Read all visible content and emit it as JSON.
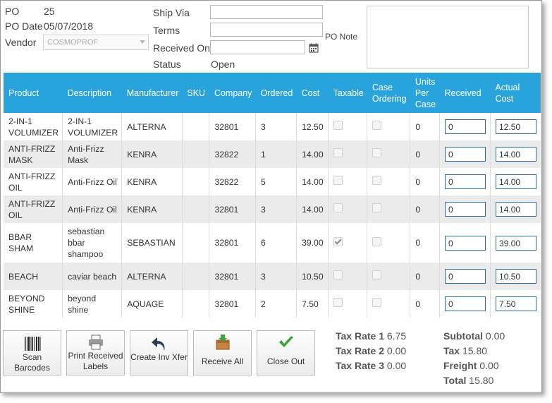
{
  "header": {
    "po_label": "PO",
    "po_value": "25",
    "po_date_label": "PO Date",
    "po_date_value": "05/07/2018",
    "vendor_label": "Vendor",
    "vendor_value": "COSMOPROF",
    "ship_via_label": "Ship Via",
    "ship_via_value": "",
    "terms_label": "Terms",
    "terms_value": "",
    "received_on_label": "Received On",
    "received_on_value": "",
    "status_label": "Status",
    "status_value": "Open",
    "po_note_label": "PO Note",
    "po_note_value": ""
  },
  "table": {
    "columns": [
      "Product",
      "Description",
      "Manufacturer",
      "SKU",
      "Company",
      "Ordered",
      "Cost",
      "Taxable",
      "Case Ordering",
      "Units Per Case",
      "Received",
      "Actual Cost"
    ],
    "rows": [
      {
        "product": "2-IN-1 VOLUMIZER",
        "description": "2-IN-1 VOLUMIZER",
        "manufacturer": "ALTERNA",
        "sku": "",
        "company": "32801",
        "ordered": "3",
        "cost": "12.50",
        "taxable": false,
        "case_ordering": false,
        "units_per_case": "0",
        "received": "0",
        "actual_cost": "12.50"
      },
      {
        "product": "ANTI-FRIZZ MASK",
        "description": "Anti-Frizz Mask",
        "manufacturer": "KENRA",
        "sku": "",
        "company": "32822",
        "ordered": "1",
        "cost": "14.00",
        "taxable": false,
        "case_ordering": false,
        "units_per_case": "0",
        "received": "0",
        "actual_cost": "14.00"
      },
      {
        "product": "ANTI-FRIZZ OIL",
        "description": "Anti-Frizz Oil",
        "manufacturer": "KENRA",
        "sku": "",
        "company": "32822",
        "ordered": "5",
        "cost": "14.00",
        "taxable": false,
        "case_ordering": false,
        "units_per_case": "0",
        "received": "0",
        "actual_cost": "14.00"
      },
      {
        "product": "ANTI-FRIZZ OIL",
        "description": "Anti-Frizz Oil",
        "manufacturer": "KENRA",
        "sku": "",
        "company": "32801",
        "ordered": "3",
        "cost": "14.00",
        "taxable": false,
        "case_ordering": false,
        "units_per_case": "0",
        "received": "0",
        "actual_cost": "14.00"
      },
      {
        "product": "BBAR SHAM",
        "description": "sebastian bbar shampoo",
        "manufacturer": "SEBASTIAN",
        "sku": "",
        "company": "32801",
        "ordered": "6",
        "cost": "39.00",
        "taxable": true,
        "case_ordering": false,
        "units_per_case": "0",
        "received": "0",
        "actual_cost": "39.00"
      },
      {
        "product": "BEACH",
        "description": "caviar beach",
        "manufacturer": "ALTERNA",
        "sku": "",
        "company": "32801",
        "ordered": "3",
        "cost": "10.50",
        "taxable": false,
        "case_ordering": false,
        "units_per_case": "0",
        "received": "0",
        "actual_cost": "10.50"
      },
      {
        "product": "BEYOND SHINE",
        "description": "beyond shine",
        "manufacturer": "AQUAGE",
        "sku": "",
        "company": "32801",
        "ordered": "2",
        "cost": "7.50",
        "taxable": false,
        "case_ordering": false,
        "units_per_case": "0",
        "received": "0",
        "actual_cost": "7.50"
      }
    ]
  },
  "buttons": {
    "scan": "Scan Barcodes",
    "print": "Print Received Labels",
    "create": "Create Inv Xfer",
    "receive_all": "Receive All",
    "close_out": "Close Out"
  },
  "icons": {
    "scan": "barcode-icon",
    "print": "printer-icon",
    "create": "undo-arrow-icon",
    "receive_all": "inbox-download-icon",
    "close_out": "checkmark-icon",
    "calendar": "calendar-icon"
  },
  "tax": {
    "rate1_label": "Tax Rate 1",
    "rate1_value": "6.75",
    "rate2_label": "Tax Rate 2",
    "rate2_value": "0.00",
    "rate3_label": "Tax Rate 3",
    "rate3_value": "0.00"
  },
  "totals": {
    "subtotal_label": "Subtotal",
    "subtotal_value": "0.00",
    "tax_label": "Tax",
    "tax_value": "15.80",
    "freight_label": "Freight",
    "freight_value": "0.00",
    "total_label": "Total",
    "total_value": "15.80"
  },
  "colors": {
    "header_blue": "#29a3dc",
    "input_border": "#2e6da4",
    "row_alt": "#ebebeb",
    "check_green": "#3aa53a"
  }
}
